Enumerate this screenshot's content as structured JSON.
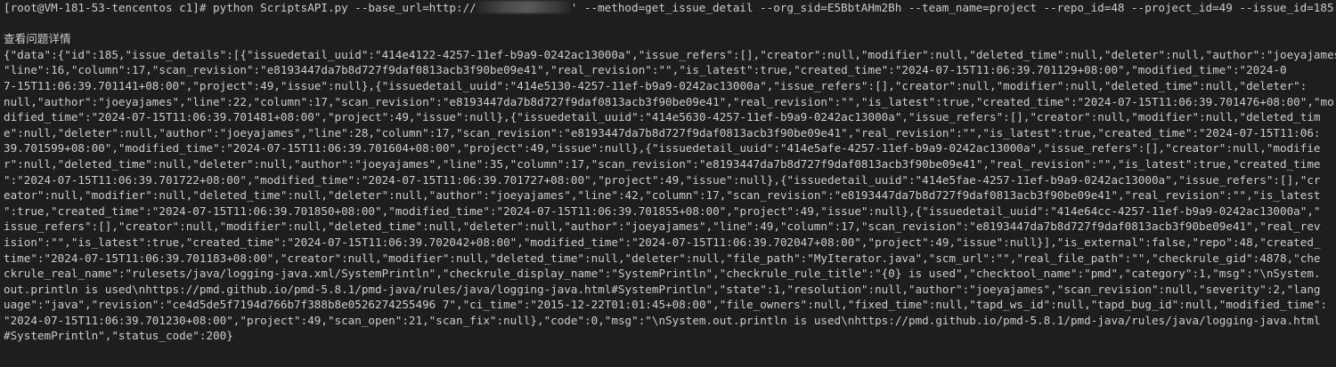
{
  "terminal": {
    "prompt": "[root@VM-181-53-tencentos c1]# ",
    "command_before_redaction": "python ScriptsAPI.py --base_url=http://",
    "command_after_redaction": "' --method=get_issue_detail --org_sid=E5BbtAHm2Bh --team_name=project --repo_id=48 --project_id=49 --issue_id=185",
    "heading": "查看问题详情",
    "output_lines": [
      "{\"data\":{\"id\":185,\"issue_details\":[{\"issuedetail_uuid\":\"414e4122-4257-11ef-b9a9-0242ac13000a\",\"issue_refers\":[],\"creator\":null,\"modifier\":null,\"deleted_time\":null,\"deleter\":null,\"author\":\"joeyajames\",",
      "\"line\":16,\"column\":17,\"scan_revision\":\"e8193447da7b8d727f9daf0813acb3f90be09e41\",\"real_revision\":\"\",\"is_latest\":true,\"created_time\":\"2024-07-15T11:06:39.701129+08:00\",\"modified_time\":\"2024-0",
      "7-15T11:06:39.701141+08:00\",\"project\":49,\"issue\":null},{\"issuedetail_uuid\":\"414e5130-4257-11ef-b9a9-0242ac13000a\",\"issue_refers\":[],\"creator\":null,\"modifier\":null,\"deleted_time\":null,\"deleter\":",
      "null,\"author\":\"joeyajames\",\"line\":22,\"column\":17,\"scan_revision\":\"e8193447da7b8d727f9daf0813acb3f90be09e41\",\"real_revision\":\"\",\"is_latest\":true,\"created_time\":\"2024-07-15T11:06:39.701476+08:00\",\"mo",
      "dified_time\":\"2024-07-15T11:06:39.701481+08:00\",\"project\":49,\"issue\":null},{\"issuedetail_uuid\":\"414e5630-4257-11ef-b9a9-0242ac13000a\",\"issue_refers\":[],\"creator\":null,\"modifier\":null,\"deleted_tim",
      "e\":null,\"deleter\":null,\"author\":\"joeyajames\",\"line\":28,\"column\":17,\"scan_revision\":\"e8193447da7b8d727f9daf0813acb3f90be09e41\",\"real_revision\":\"\",\"is_latest\":true,\"created_time\":\"2024-07-15T11:06:",
      "39.701599+08:00\",\"modified_time\":\"2024-07-15T11:06:39.701604+08:00\",\"project\":49,\"issue\":null},{\"issuedetail_uuid\":\"414e5afe-4257-11ef-b9a9-0242ac13000a\",\"issue_refers\":[],\"creator\":null,\"modifie",
      "r\":null,\"deleted_time\":null,\"deleter\":null,\"author\":\"joeyajames\",\"line\":35,\"column\":17,\"scan_revision\":\"e8193447da7b8d727f9daf0813acb3f90be09e41\",\"real_revision\":\"\",\"is_latest\":true,\"created_time",
      "\":\"2024-07-15T11:06:39.701722+08:00\",\"modified_time\":\"2024-07-15T11:06:39.701727+08:00\",\"project\":49,\"issue\":null},{\"issuedetail_uuid\":\"414e5fae-4257-11ef-b9a9-0242ac13000a\",\"issue_refers\":[],\"cr",
      "eator\":null,\"modifier\":null,\"deleted_time\":null,\"deleter\":null,\"author\":\"joeyajames\",\"line\":42,\"column\":17,\"scan_revision\":\"e8193447da7b8d727f9daf0813acb3f90be09e41\",\"real_revision\":\"\",\"is_latest",
      "\":true,\"created_time\":\"2024-07-15T11:06:39.701850+08:00\",\"modified_time\":\"2024-07-15T11:06:39.701855+08:00\",\"project\":49,\"issue\":null},{\"issuedetail_uuid\":\"414e64cc-4257-11ef-b9a9-0242ac13000a\",\"",
      "issue_refers\":[],\"creator\":null,\"modifier\":null,\"deleted_time\":null,\"deleter\":null,\"author\":\"joeyajames\",\"line\":49,\"column\":17,\"scan_revision\":\"e8193447da7b8d727f9daf0813acb3f90be09e41\",\"real_rev",
      "ision\":\"\",\"is_latest\":true,\"created_time\":\"2024-07-15T11:06:39.702042+08:00\",\"modified_time\":\"2024-07-15T11:06:39.702047+08:00\",\"project\":49,\"issue\":null}],\"is_external\":false,\"repo\":48,\"created_",
      "time\":\"2024-07-15T11:06:39.701183+08:00\",\"creator\":null,\"modifier\":null,\"deleted_time\":null,\"deleter\":null,\"file_path\":\"MyIterator.java\",\"scm_url\":\"\",\"real_file_path\":\"\",\"checkrule_gid\":4878,\"che",
      "ckrule_real_name\":\"rulesets/java/logging-java.xml/SystemPrintln\",\"checkrule_display_name\":\"SystemPrintln\",\"checkrule_rule_title\":\"{0} is used\",\"checktool_name\":\"pmd\",\"category\":1,\"msg\":\"\\nSystem.",
      "out.println is used\\nhttps://pmd.github.io/pmd-5.8.1/pmd-java/rules/java/logging-java.html#SystemPrintln\",\"state\":1,\"resolution\":null,\"author\":\"joeyajames\",\"scan_revision\":null,\"severity\":2,\"lang",
      "uage\":\"java\",\"revision\":\"ce4d5de5f7194d766b7f388b8e0526274255496 7\",\"ci_time\":\"2015-12-22T01:01:45+08:00\",\"file_owners\":null,\"fixed_time\":null,\"tapd_ws_id\":null,\"tapd_bug_id\":null,\"modified_time\":",
      "\"2024-07-15T11:06:39.701230+08:00\",\"project\":49,\"scan_open\":21,\"scan_fix\":null},\"code\":0,\"msg\":\"\\nSystem.out.println is used\\nhttps://pmd.github.io/pmd-5.8.1/pmd-java/rules/java/logging-java.html",
      "#SystemPrintln\",\"status_code\":200}"
    ]
  }
}
